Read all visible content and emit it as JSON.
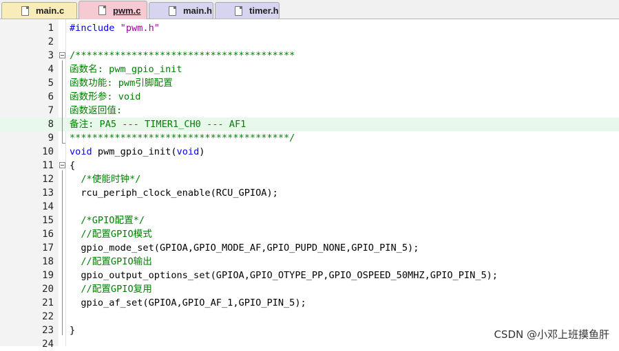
{
  "tabs": [
    {
      "label": "main.c",
      "color": "#f8edb8",
      "active": false
    },
    {
      "label": "pwm.c",
      "color": "#f7c9d3",
      "active": true
    },
    {
      "label": "main.h",
      "color": "#d6d4ee",
      "active": false
    },
    {
      "label": "timer.h",
      "color": "#d6d4ee",
      "active": false
    }
  ],
  "highlighted_line": 8,
  "lines": [
    {
      "n": "1",
      "parts": [
        [
          "kw",
          "#include "
        ],
        [
          "str",
          "\"pwm.h\""
        ]
      ]
    },
    {
      "n": "2",
      "parts": []
    },
    {
      "n": "3",
      "parts": [
        [
          "cm",
          "/***************************************"
        ]
      ]
    },
    {
      "n": "4",
      "parts": [
        [
          "cm",
          "函数名: pwm_gpio_init"
        ]
      ]
    },
    {
      "n": "5",
      "parts": [
        [
          "cm",
          "函数功能: pwm引脚配置"
        ]
      ]
    },
    {
      "n": "6",
      "parts": [
        [
          "cm",
          "函数形参: void"
        ]
      ]
    },
    {
      "n": "7",
      "parts": [
        [
          "cm",
          "函数返回值:"
        ]
      ]
    },
    {
      "n": "8",
      "parts": [
        [
          "cm",
          "备注: PA5 --- TIMER1_CH0 --- AF1"
        ]
      ]
    },
    {
      "n": "9",
      "parts": [
        [
          "cm",
          "***************************************/"
        ]
      ]
    },
    {
      "n": "10",
      "parts": [
        [
          "kw",
          "void"
        ],
        [
          "",
          " pwm_gpio_init("
        ],
        [
          "kw",
          "void"
        ],
        [
          "",
          ")"
        ]
      ]
    },
    {
      "n": "11",
      "parts": [
        [
          "",
          "{"
        ]
      ]
    },
    {
      "n": "12",
      "parts": [
        [
          "",
          "  "
        ],
        [
          "cm",
          "/*使能时钟*/"
        ]
      ]
    },
    {
      "n": "13",
      "parts": [
        [
          "",
          "  rcu_periph_clock_enable(RCU_GPIOA);"
        ]
      ]
    },
    {
      "n": "14",
      "parts": []
    },
    {
      "n": "15",
      "parts": [
        [
          "",
          "  "
        ],
        [
          "cm",
          "/*GPIO配置*/"
        ]
      ]
    },
    {
      "n": "16",
      "parts": [
        [
          "",
          "  "
        ],
        [
          "cm",
          "//配置GPIO模式"
        ]
      ]
    },
    {
      "n": "17",
      "parts": [
        [
          "",
          "  gpio_mode_set(GPIOA,GPIO_MODE_AF,GPIO_PUPD_NONE,GPIO_PIN_5);"
        ]
      ]
    },
    {
      "n": "18",
      "parts": [
        [
          "",
          "  "
        ],
        [
          "cm",
          "//配置GPIO输出"
        ]
      ]
    },
    {
      "n": "19",
      "parts": [
        [
          "",
          "  gpio_output_options_set(GPIOA,GPIO_OTYPE_PP,GPIO_OSPEED_50MHZ,GPIO_PIN_5);"
        ]
      ]
    },
    {
      "n": "20",
      "parts": [
        [
          "",
          "  "
        ],
        [
          "cm",
          "//配置GPIO复用"
        ]
      ]
    },
    {
      "n": "21",
      "parts": [
        [
          "",
          "  gpio_af_set(GPIOA,GPIO_AF_1,GPIO_PIN_5);"
        ]
      ]
    },
    {
      "n": "22",
      "parts": []
    },
    {
      "n": "23",
      "parts": [
        [
          "",
          "}"
        ]
      ]
    },
    {
      "n": "24",
      "parts": []
    }
  ],
  "watermark": "CSDN @小邓上班摸鱼肝"
}
